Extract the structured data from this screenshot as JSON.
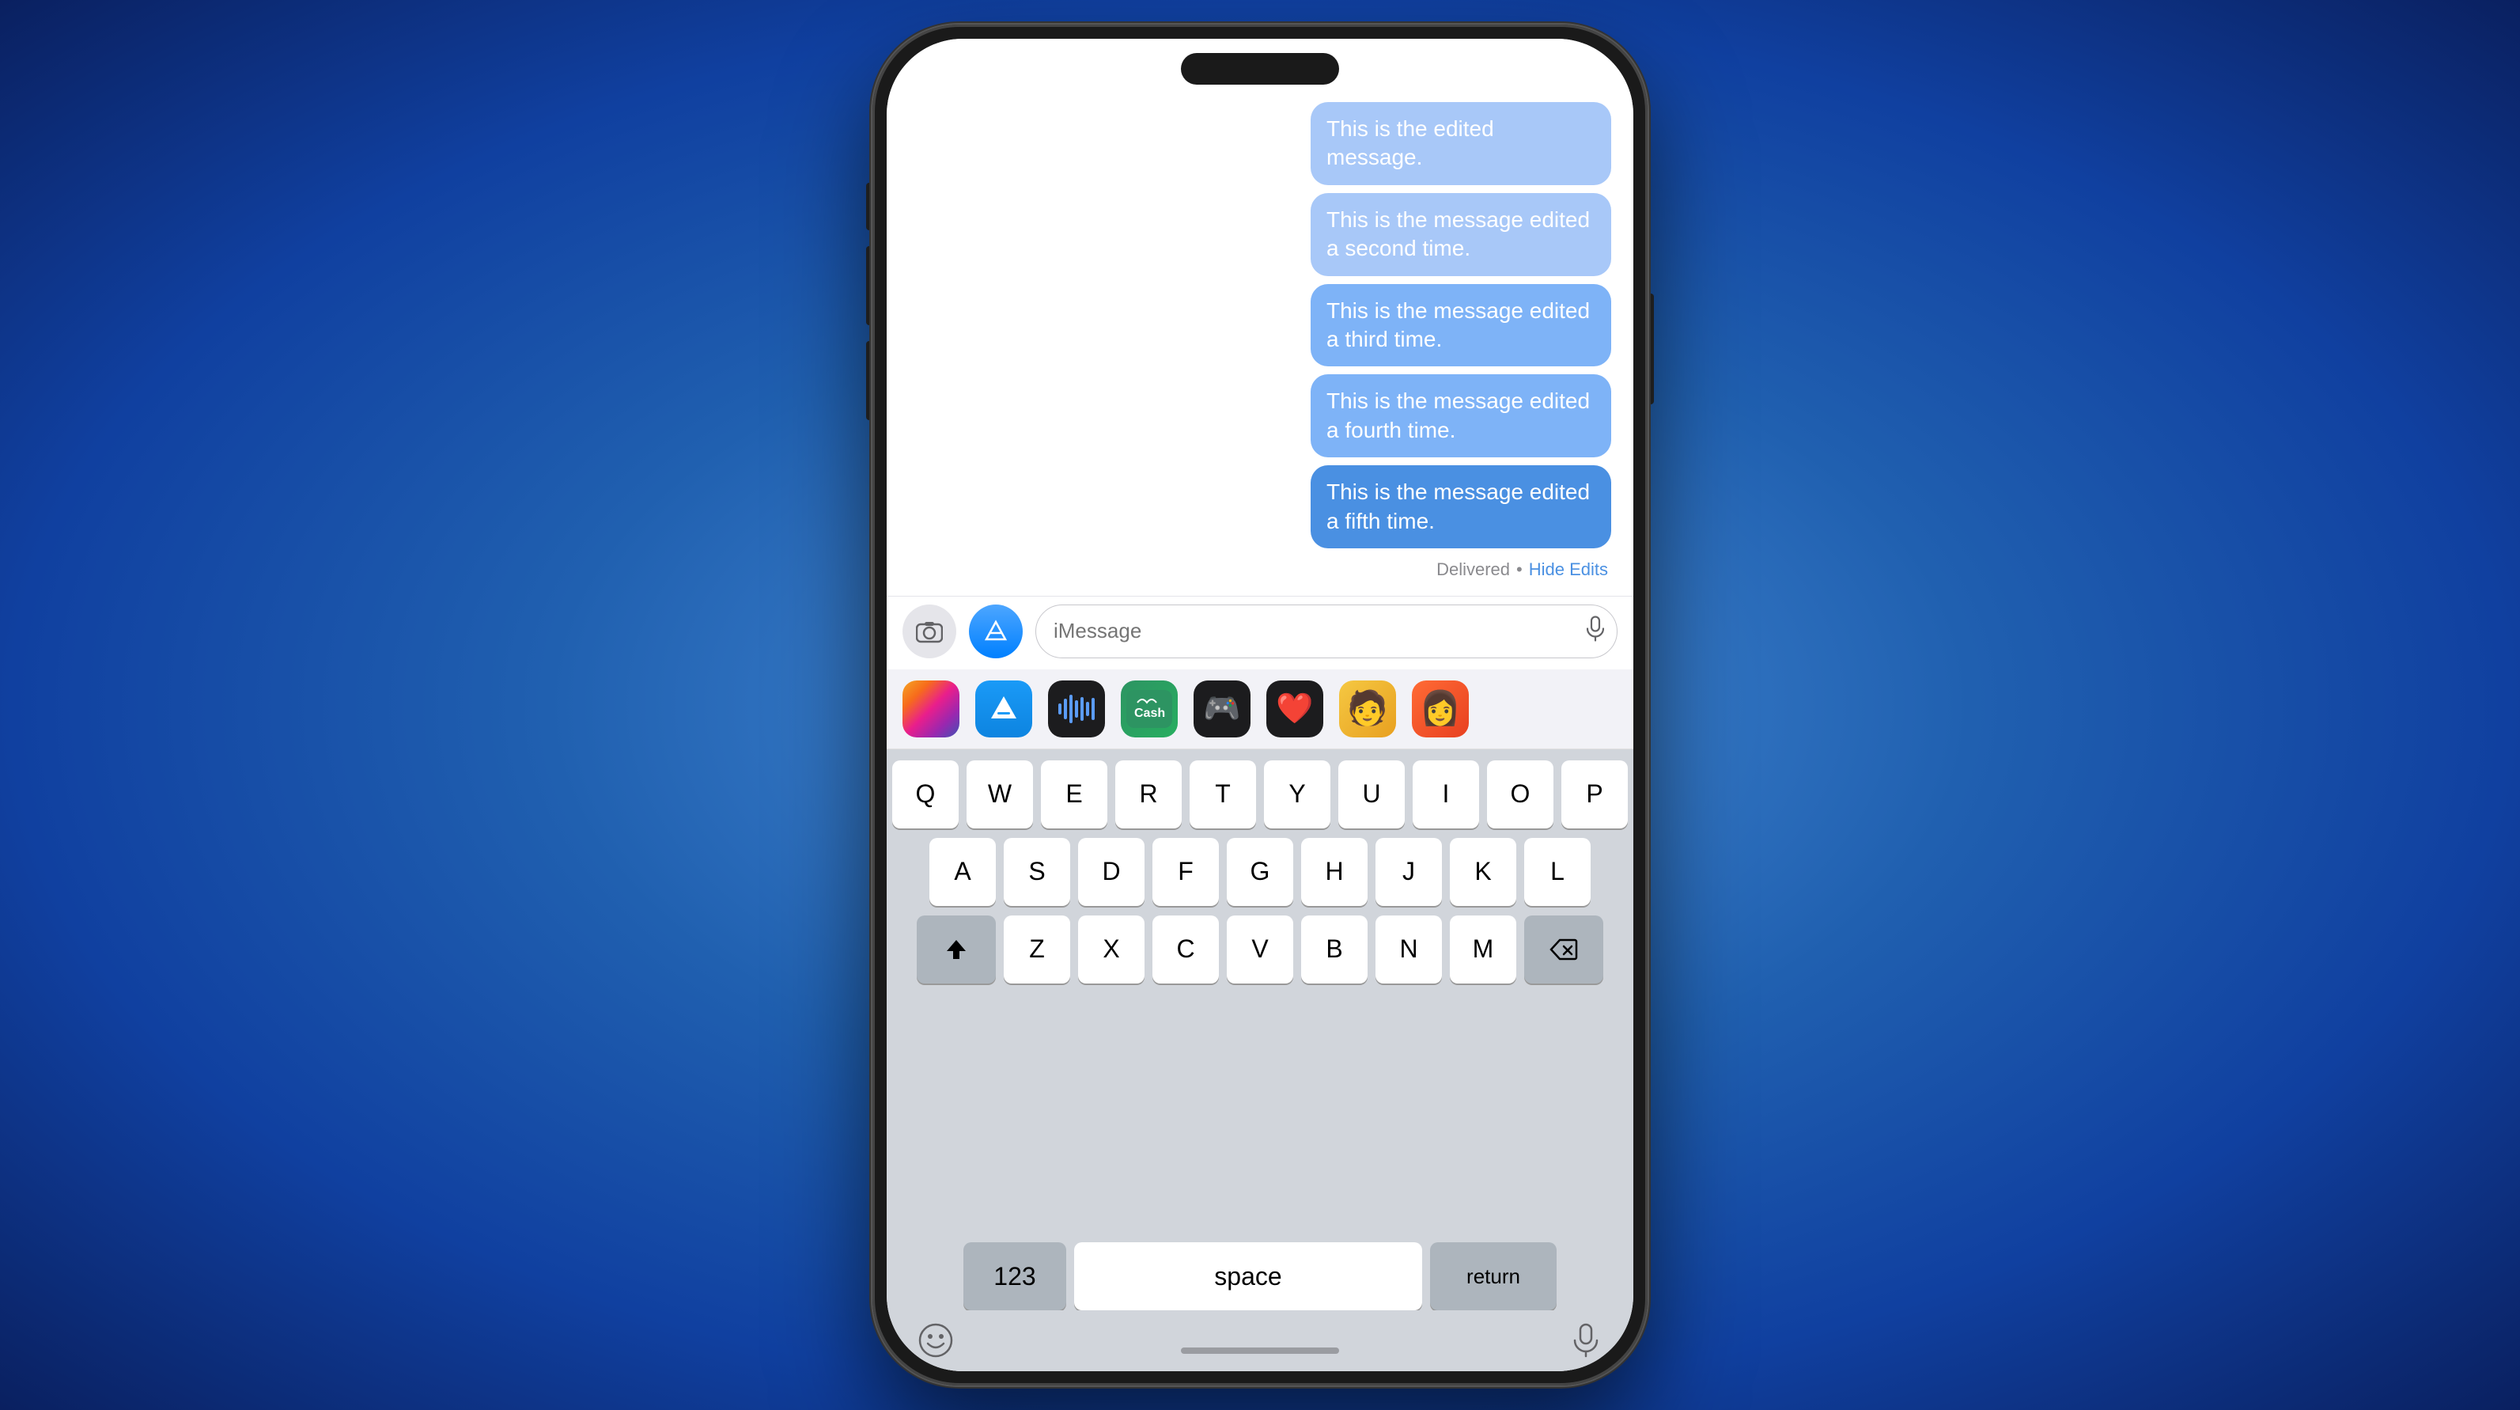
{
  "phone": {
    "messages": [
      {
        "id": "msg1",
        "text": "This is the edited message.",
        "shade": "light"
      },
      {
        "id": "msg2",
        "text": "This is the message edited a second time.",
        "shade": "light"
      },
      {
        "id": "msg3",
        "text": "This is the message edited a third time.",
        "shade": "medium"
      },
      {
        "id": "msg4",
        "text": "This is the message edited a fourth time.",
        "shade": "medium"
      },
      {
        "id": "msg5",
        "text": "This is the message edited a fifth time.",
        "shade": "blue"
      }
    ],
    "delivered_label": "Delivered",
    "separator": "•",
    "hide_edits_label": "Hide Edits",
    "input_placeholder": "iMessage",
    "keyboard": {
      "row1": [
        "Q",
        "W",
        "E",
        "R",
        "T",
        "Y",
        "U",
        "I",
        "O",
        "P"
      ],
      "row2": [
        "A",
        "S",
        "D",
        "F",
        "G",
        "H",
        "J",
        "K",
        "L"
      ],
      "row3": [
        "Z",
        "X",
        "C",
        "V",
        "B",
        "N",
        "M"
      ],
      "numbers_label": "123",
      "space_label": "space",
      "return_label": "return"
    },
    "app_strip": [
      {
        "id": "photos",
        "label": "Photos"
      },
      {
        "id": "appstore",
        "label": "App Store"
      },
      {
        "id": "audio",
        "label": "Audio Messages"
      },
      {
        "id": "cash",
        "label": "Apple Cash"
      },
      {
        "id": "rainbow",
        "label": "Game Center"
      },
      {
        "id": "heart",
        "label": "Digital Touch"
      },
      {
        "id": "memoji1",
        "label": "Memoji 1"
      },
      {
        "id": "memoji2",
        "label": "Memoji 2"
      }
    ]
  }
}
